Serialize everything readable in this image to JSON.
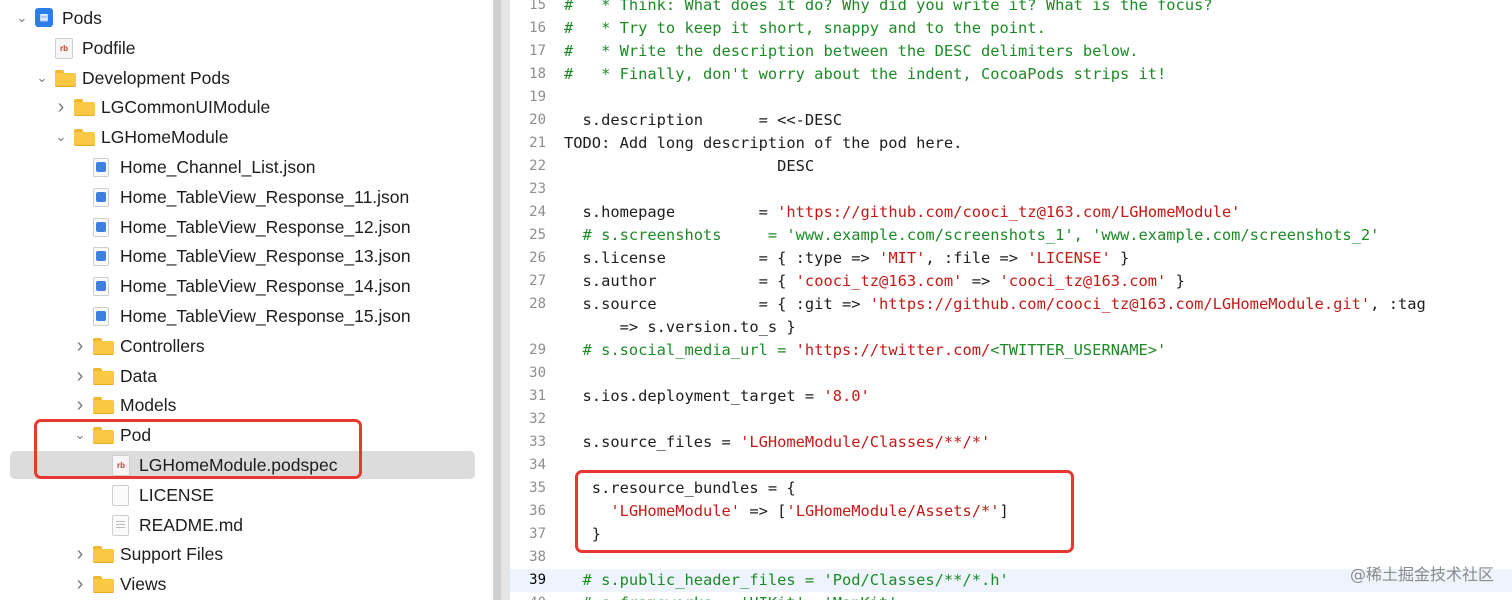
{
  "navigator": {
    "items": [
      {
        "label": "Pods",
        "depth": 0,
        "icon": "pods-project-icon",
        "chevron": "expanded"
      },
      {
        "label": "Podfile",
        "depth": 1,
        "icon": "ruby-file-icon",
        "chevron": "none"
      },
      {
        "label": "Development Pods",
        "depth": 1,
        "icon": "folder-icon",
        "chevron": "expanded"
      },
      {
        "label": "LGCommonUIModule",
        "depth": 2,
        "icon": "folder-icon",
        "chevron": "collapsed"
      },
      {
        "label": "LGHomeModule",
        "depth": 2,
        "icon": "folder-icon",
        "chevron": "expanded"
      },
      {
        "label": "Home_Channel_List.json",
        "depth": 3,
        "icon": "json-file-icon",
        "chevron": "none"
      },
      {
        "label": "Home_TableView_Response_11.json",
        "depth": 3,
        "icon": "json-file-icon",
        "chevron": "none"
      },
      {
        "label": "Home_TableView_Response_12.json",
        "depth": 3,
        "icon": "json-file-icon",
        "chevron": "none"
      },
      {
        "label": "Home_TableView_Response_13.json",
        "depth": 3,
        "icon": "json-file-icon",
        "chevron": "none"
      },
      {
        "label": "Home_TableView_Response_14.json",
        "depth": 3,
        "icon": "json-file-icon",
        "chevron": "none"
      },
      {
        "label": "Home_TableView_Response_15.json",
        "depth": 3,
        "icon": "json-file-icon",
        "chevron": "none"
      },
      {
        "label": "Controllers",
        "depth": 3,
        "icon": "folder-icon",
        "chevron": "collapsed"
      },
      {
        "label": "Data",
        "depth": 3,
        "icon": "folder-icon",
        "chevron": "collapsed"
      },
      {
        "label": "Models",
        "depth": 3,
        "icon": "folder-icon",
        "chevron": "collapsed"
      },
      {
        "label": "Pod",
        "depth": 3,
        "icon": "folder-icon",
        "chevron": "expanded"
      },
      {
        "label": "LGHomeModule.podspec",
        "depth": 4,
        "icon": "ruby-file-icon",
        "chevron": "none",
        "selected": true
      },
      {
        "label": "LICENSE",
        "depth": 4,
        "icon": "document-icon",
        "chevron": "none"
      },
      {
        "label": "README.md",
        "depth": 4,
        "icon": "markdown-file-icon",
        "chevron": "none"
      },
      {
        "label": "Support Files",
        "depth": 3,
        "icon": "folder-icon",
        "chevron": "collapsed"
      },
      {
        "label": "Views",
        "depth": 3,
        "icon": "folder-icon",
        "chevron": "collapsed"
      }
    ]
  },
  "editor": {
    "current_line": "39",
    "lines": [
      {
        "n": "15",
        "tokens": [
          {
            "t": "#   * Think: What does it do? Why did you write it? What is the focus?",
            "c": "tc"
          }
        ]
      },
      {
        "n": "16",
        "tokens": [
          {
            "t": "#   * Try to keep it short, snappy and to the point.",
            "c": "tc"
          }
        ]
      },
      {
        "n": "17",
        "tokens": [
          {
            "t": "#   * Write the description between the DESC delimiters below.",
            "c": "tc"
          }
        ]
      },
      {
        "n": "18",
        "tokens": [
          {
            "t": "#   * Finally, don't worry about the indent, CocoaPods strips it!",
            "c": "tc"
          }
        ]
      },
      {
        "n": "19",
        "tokens": []
      },
      {
        "n": "20",
        "tokens": [
          {
            "t": "  s.description      = <<-DESC",
            "c": "tt"
          }
        ]
      },
      {
        "n": "21",
        "tokens": [
          {
            "t": "TODO: Add long description of the pod here.",
            "c": "tt"
          }
        ]
      },
      {
        "n": "22",
        "tokens": [
          {
            "t": "                       DESC",
            "c": "tt"
          }
        ]
      },
      {
        "n": "23",
        "tokens": []
      },
      {
        "n": "24",
        "tokens": [
          {
            "t": "  s.homepage         = ",
            "c": "tt"
          },
          {
            "t": "'https://github.com/cooci_tz@163.com/LGHomeModule'",
            "c": "ts"
          }
        ]
      },
      {
        "n": "25",
        "tokens": [
          {
            "t": "  # s.screenshots     = 'www.example.com/screenshots_1', 'www.example.com/screenshots_2'",
            "c": "tc"
          }
        ]
      },
      {
        "n": "26",
        "tokens": [
          {
            "t": "  s.license          = { :type => ",
            "c": "tt"
          },
          {
            "t": "'MIT'",
            "c": "ts"
          },
          {
            "t": ", :file => ",
            "c": "tt"
          },
          {
            "t": "'LICENSE'",
            "c": "ts"
          },
          {
            "t": " }",
            "c": "tt"
          }
        ]
      },
      {
        "n": "27",
        "tokens": [
          {
            "t": "  s.author           = { ",
            "c": "tt"
          },
          {
            "t": "'cooci_tz@163.com'",
            "c": "ts"
          },
          {
            "t": " => ",
            "c": "tt"
          },
          {
            "t": "'cooci_tz@163.com'",
            "c": "ts"
          },
          {
            "t": " }",
            "c": "tt"
          }
        ]
      },
      {
        "n": "28",
        "tokens": [
          {
            "t": "  s.source           = { :git => ",
            "c": "tt"
          },
          {
            "t": "'https://github.com/cooci_tz@163.com/LGHomeModule.git'",
            "c": "ts"
          },
          {
            "t": ", :tag",
            "c": "tt"
          }
        ]
      },
      {
        "n": "",
        "tokens": [
          {
            "t": "      => s.version.to_s }",
            "c": "tt"
          }
        ]
      },
      {
        "n": "29",
        "tokens": [
          {
            "t": "  # s.social_media_url = ",
            "c": "tc"
          },
          {
            "t": "'https://twitter.com/",
            "c": "ts"
          },
          {
            "t": "<TWITTER_USERNAME>'",
            "c": "tc"
          }
        ]
      },
      {
        "n": "30",
        "tokens": []
      },
      {
        "n": "31",
        "tokens": [
          {
            "t": "  s.ios.deployment_target = ",
            "c": "tt"
          },
          {
            "t": "'8.0'",
            "c": "ts"
          }
        ]
      },
      {
        "n": "32",
        "tokens": []
      },
      {
        "n": "33",
        "tokens": [
          {
            "t": "  s.source_files = ",
            "c": "tt"
          },
          {
            "t": "'LGHomeModule/Classes/**/*'",
            "c": "ts"
          }
        ]
      },
      {
        "n": "34",
        "tokens": []
      },
      {
        "n": "35",
        "tokens": [
          {
            "t": "   s.resource_bundles = {",
            "c": "tt"
          }
        ]
      },
      {
        "n": "36",
        "tokens": [
          {
            "t": "     ",
            "c": "tt"
          },
          {
            "t": "'LGHomeModule'",
            "c": "ts"
          },
          {
            "t": " => [",
            "c": "tt"
          },
          {
            "t": "'LGHomeModule/Assets/*'",
            "c": "ts"
          },
          {
            "t": "]",
            "c": "tt"
          }
        ]
      },
      {
        "n": "37",
        "tokens": [
          {
            "t": "   }",
            "c": "tt"
          }
        ]
      },
      {
        "n": "38",
        "tokens": []
      },
      {
        "n": "39",
        "tokens": [
          {
            "t": "  # s.public_header_files = 'Pod/Classes/**/*.h'",
            "c": "tc"
          }
        ]
      },
      {
        "n": "40",
        "tokens": [
          {
            "t": "  # s.frameworks = 'UIKit', 'MapKit'",
            "c": "tc"
          }
        ]
      }
    ]
  },
  "watermark": "@稀土掘金技术社区"
}
